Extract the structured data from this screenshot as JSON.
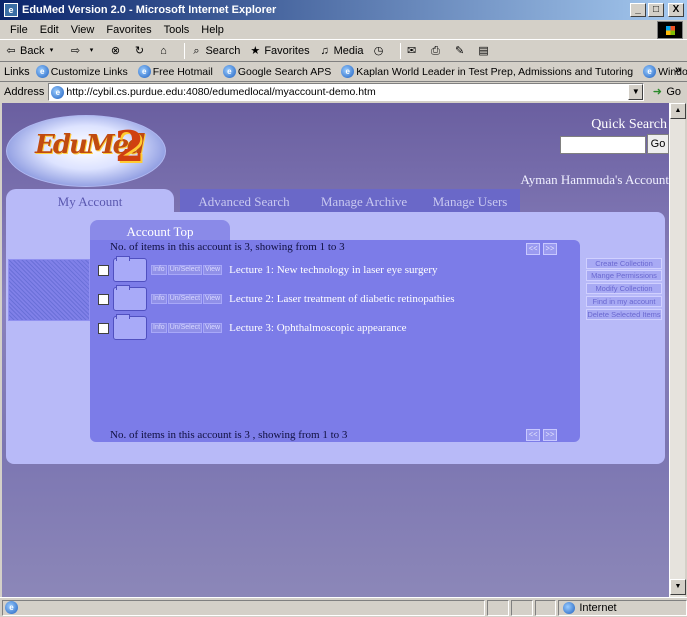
{
  "window": {
    "title": "EduMed Version 2.0 - Microsoft Internet Explorer",
    "min": "_",
    "max": "□",
    "close": "X"
  },
  "menu": [
    "File",
    "Edit",
    "View",
    "Favorites",
    "Tools",
    "Help"
  ],
  "toolbar": {
    "back": "Back",
    "search": "Search",
    "favorites": "Favorites",
    "media": "Media"
  },
  "links": {
    "label": "Links",
    "items": [
      "Customize Links",
      "Free Hotmail",
      "Google Search APS",
      "Kaplan World Leader in Test Prep, Admissions and Tutoring",
      "Windows Media"
    ]
  },
  "address": {
    "label": "Address",
    "url": "http://cybil.cs.purdue.edu:4080/edumedlocal/myaccount-demo.htm",
    "go": "Go"
  },
  "page": {
    "logo": {
      "text": "EduMed",
      "number": "2"
    },
    "quick_search": {
      "label": "Quick Search",
      "go": "Go"
    },
    "username": "Ayman Hammuda's Account",
    "tabs": [
      "My Account",
      "Advanced Search",
      "Manage Archive",
      "Manage Users"
    ],
    "account_tab": "Account Top",
    "count_top": "No. of items in this account is 3, showing from 1 to 3",
    "count_bottom": "No. of items in this account is 3 , showing from 1 to 3",
    "item_buttons": [
      "Info",
      "Un/Select",
      "View"
    ],
    "lectures": [
      "Lecture 1: New technology in laser eye surgery",
      "Lecture 2: Laser treatment of diabetic retinopathies",
      "Lecture 3: Ophthalmoscopic appearance"
    ],
    "actions": [
      "Create Collection",
      "Mange Permissions",
      "Modify Collection",
      "Find in my account",
      "Delete Selected Items"
    ]
  },
  "status": {
    "zone": "Internet"
  }
}
